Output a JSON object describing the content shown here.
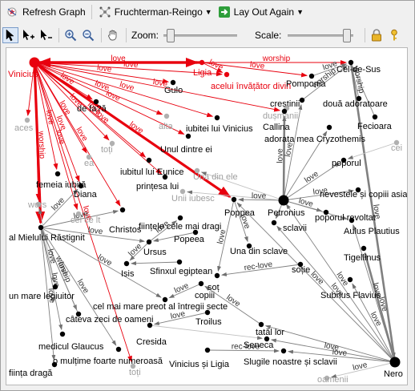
{
  "toolbar": {
    "refresh_label": "Refresh Graph",
    "layout_algorithm": "Fruchterman-Reingo",
    "lay_out_again_label": "Lay Out Again",
    "zoom_label": "Zoom:",
    "scale_label": "Scale:",
    "zoom_level": 0.05,
    "scale_level": 0.95
  },
  "colors": {
    "strong_edge": "#e8000e",
    "normal_edge": "#808080",
    "faint_node": "#b0b0b0"
  },
  "graph": {
    "nodes": [
      {
        "id": "vinicius",
        "label": "Vinicius",
        "size": "large",
        "color": "#e8000e"
      },
      {
        "id": "ligia",
        "label": "Ligia",
        "size": "small",
        "color": "#e8000e"
      },
      {
        "id": "acelui",
        "label": "acelui învățător divin",
        "size": "small",
        "color": "#e8000e"
      },
      {
        "id": "celdesus",
        "label": "Cel-de-Sus",
        "size": "small",
        "color": "#000"
      },
      {
        "id": "pomponia",
        "label": "Pomponia",
        "size": "small",
        "color": "#000"
      },
      {
        "id": "crestinii",
        "label": "creștinii",
        "size": "small",
        "color": "#000"
      },
      {
        "id": "douaador",
        "label": "două adoratoare",
        "size": "small",
        "color": "#000"
      },
      {
        "id": "fecioara",
        "label": "Fecioara",
        "size": "small",
        "color": "#000"
      },
      {
        "id": "gulo",
        "label": "Gulo",
        "size": "small",
        "color": "#000"
      },
      {
        "id": "defaa",
        "label": "de fa?ă",
        "size": "small",
        "color": "#000"
      },
      {
        "id": "aces",
        "label": "aces",
        "size": "small",
        "color": "#b0b0b0"
      },
      {
        "id": "alta",
        "label": "alta",
        "size": "small",
        "color": "#b0b0b0"
      },
      {
        "id": "dusmanii",
        "label": "dușmanii",
        "size": "small",
        "color": "#b0b0b0"
      },
      {
        "id": "iubitei",
        "label": "iubitei lui Vinicius",
        "size": "small",
        "color": "#000"
      },
      {
        "id": "callina",
        "label": "Callina",
        "size": "small",
        "color": "#000"
      },
      {
        "id": "adorata",
        "label": "adorata mea Cryzothemis",
        "size": "small",
        "color": "#000"
      },
      {
        "id": "cei",
        "label": "cei",
        "size": "small",
        "color": "#b0b0b0"
      },
      {
        "id": "unuldintre",
        "label": "Unul dintre ei",
        "size": "small",
        "color": "#000"
      },
      {
        "id": "toti1",
        "label": "toți",
        "size": "small",
        "color": "#b0b0b0"
      },
      {
        "id": "ea",
        "label": "ea",
        "size": "small",
        "color": "#b0b0b0"
      },
      {
        "id": "poporul",
        "label": "poporul",
        "size": "small",
        "color": "#000"
      },
      {
        "id": "iubitullui",
        "label": "iubitul lui Eunice",
        "size": "small",
        "color": "#000"
      },
      {
        "id": "femeia",
        "label": "femeia iubită",
        "size": "small",
        "color": "#000"
      },
      {
        "id": "printesa",
        "label": "prințesa lui",
        "size": "small",
        "color": "#000"
      },
      {
        "id": "unadinele",
        "label": "Una din ele",
        "size": "small",
        "color": "#b0b0b0"
      },
      {
        "id": "nevestele",
        "label": "nevestele și copiii asian",
        "size": "small",
        "color": "#000"
      },
      {
        "id": "diana",
        "label": "Diana",
        "size": "small",
        "color": "#000"
      },
      {
        "id": "uniiiubesc",
        "label": "Unii iubesc",
        "size": "small",
        "color": "#b0b0b0"
      },
      {
        "id": "petronius",
        "label": "Petronius",
        "size": "large",
        "color": "#000"
      },
      {
        "id": "poppea",
        "label": "Poppea",
        "size": "small",
        "color": "#000"
      },
      {
        "id": "wors",
        "label": "wors",
        "size": "small",
        "color": "#b0b0b0"
      },
      {
        "id": "celcelt",
        "label": "cel ce lt",
        "size": "small",
        "color": "#b0b0b0"
      },
      {
        "id": "christos",
        "label": "Christos",
        "size": "small",
        "color": "#000"
      },
      {
        "id": "fiintele",
        "label": "ființele cele mai dragi",
        "size": "small",
        "color": "#000"
      },
      {
        "id": "sclavii",
        "label": "sclavii",
        "size": "small",
        "color": "#000"
      },
      {
        "id": "poporulrev",
        "label": "poporul revoltat",
        "size": "small",
        "color": "#000"
      },
      {
        "id": "aulus",
        "label": "Aulus Plautius",
        "size": "small",
        "color": "#000"
      },
      {
        "id": "almielului",
        "label": "al Mielului Răstignit",
        "size": "small",
        "color": "#000"
      },
      {
        "id": "ursus",
        "label": "Ursus",
        "size": "small",
        "color": "#000"
      },
      {
        "id": "popeea",
        "label": "Popeea",
        "size": "small",
        "color": "#000"
      },
      {
        "id": "unadinsclave",
        "label": "Una din sclave",
        "size": "small",
        "color": "#000"
      },
      {
        "id": "tigellinus",
        "label": "Tigellinus",
        "size": "small",
        "color": "#000"
      },
      {
        "id": "isis",
        "label": "Isis",
        "size": "small",
        "color": "#000"
      },
      {
        "id": "sfinxul",
        "label": "Sfinxul egiptean",
        "size": "small",
        "color": "#000"
      },
      {
        "id": "sotie",
        "label": "soție",
        "size": "small",
        "color": "#000"
      },
      {
        "id": "sot",
        "label": "soț",
        "size": "small",
        "color": "#000"
      },
      {
        "id": "unmare",
        "label": "un mare legiuitor",
        "size": "small",
        "color": "#000"
      },
      {
        "id": "copiii",
        "label": "copiii",
        "size": "small",
        "color": "#000"
      },
      {
        "id": "subrius",
        "label": "Subrius Flavius",
        "size": "small",
        "color": "#000"
      },
      {
        "id": "celmaimare",
        "label": "cel mai mare preot al întregii secte",
        "size": "small",
        "color": "#000"
      },
      {
        "id": "catevazeci",
        "label": "câteva zeci de oameni",
        "size": "small",
        "color": "#000"
      },
      {
        "id": "troilus",
        "label": "Troilus",
        "size": "small",
        "color": "#000"
      },
      {
        "id": "tatal",
        "label": "tatăl lor",
        "size": "small",
        "color": "#000"
      },
      {
        "id": "medicul",
        "label": "medicul Glaucus",
        "size": "small",
        "color": "#000"
      },
      {
        "id": "cresida",
        "label": "Cresida",
        "size": "small",
        "color": "#000"
      },
      {
        "id": "seneca",
        "label": "Seneca",
        "size": "small",
        "color": "#000"
      },
      {
        "id": "omultime",
        "label": "o mulțime foarte numeroasă",
        "size": "small",
        "color": "#000"
      },
      {
        "id": "vinicsiligia",
        "label": "Vinicius și Ligia",
        "size": "small",
        "color": "#000"
      },
      {
        "id": "slugile",
        "label": "Slugile noastre și sclavii",
        "size": "small",
        "color": "#000"
      },
      {
        "id": "fiinta",
        "label": "ființa dragă",
        "size": "small",
        "color": "#000"
      },
      {
        "id": "toti2",
        "label": "toți",
        "size": "small",
        "color": "#b0b0b0"
      },
      {
        "id": "oamenii",
        "label": "oamenii",
        "size": "small",
        "color": "#b0b0b0"
      },
      {
        "id": "nero",
        "label": "Nero",
        "size": "large",
        "color": "#000"
      }
    ],
    "edge_labels": [
      "love",
      "worship",
      "rec-love"
    ]
  }
}
